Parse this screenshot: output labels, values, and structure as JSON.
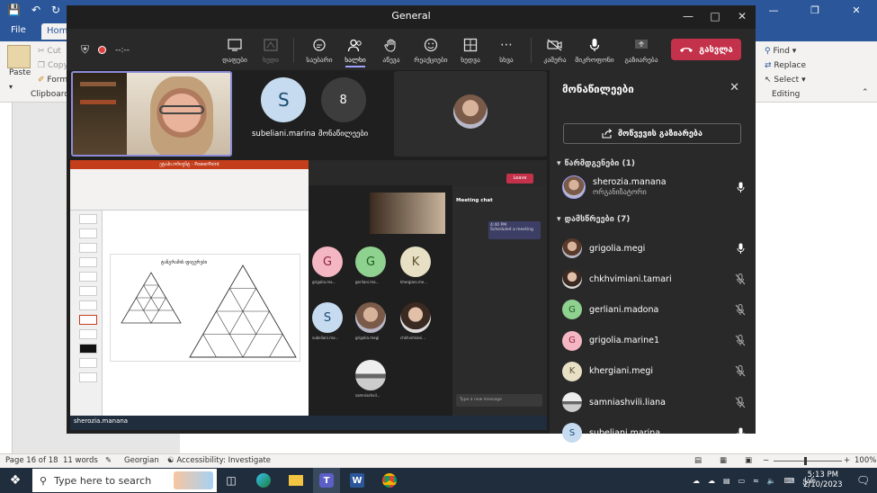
{
  "word": {
    "tabs": [
      "File",
      "Home"
    ],
    "clipboard": {
      "paste": "Paste",
      "cut": "Cut",
      "copy": "Copy",
      "format": "Forma",
      "group": "Clipboard"
    },
    "editing": {
      "find": "Find",
      "replace": "Replace",
      "select": "Select",
      "group": "Editing"
    },
    "status": {
      "page": "Page 16 of 18",
      "words": "11 words",
      "language": "Georgian",
      "accessibility": "Accessibility: Investigate",
      "zoom": "100%"
    }
  },
  "taskbar": {
    "search_placeholder": "Type here to search",
    "time": "5:13 PM",
    "date": "2/10/2023",
    "lang": "ქარ"
  },
  "teams": {
    "title": "General",
    "timer": "--:--",
    "toolbar": [
      {
        "id": "whiteboard",
        "label": "დაფები"
      },
      {
        "id": "view",
        "label": "ხედი",
        "dim": true
      },
      {
        "id": "chat",
        "label": "საუბარი"
      },
      {
        "id": "people",
        "label": "ხალხი",
        "active": true
      },
      {
        "id": "raise",
        "label": "აწევა"
      },
      {
        "id": "react",
        "label": "რეაქციები"
      },
      {
        "id": "rooms",
        "label": "ხედვა"
      },
      {
        "id": "more",
        "label": "სხვა"
      },
      {
        "id": "camera",
        "label": "კამერა"
      },
      {
        "id": "mic",
        "label": "მიკროფონი"
      },
      {
        "id": "share",
        "label": "გაზიარება"
      }
    ],
    "leave_label": "გასვლა",
    "tiles": {
      "s_initial": "S",
      "s_name": "subeliani.marina",
      "count": "8",
      "count_label": "მონაწილეები"
    },
    "shared_screen": {
      "presenter": "sherozia.manana",
      "ppt_title": "ეტაპი.ორიენტ - PowerPoint",
      "slide_title": "ტანგრამის ფიგურები",
      "meeting_chat": "Meeting chat",
      "chat_msg_time": "4:40 PM",
      "chat_msg": "Scheduled a meeting",
      "compose": "Type a new message",
      "leave": "Leave",
      "tile_initials": [
        "G",
        "G",
        "K",
        "S"
      ],
      "tile_names": [
        "grigolia.ma...",
        "gerliani.ma...",
        "khergiani.me...",
        "subeliani.ma...",
        "grigolia.megi",
        "chkhvimiani...",
        "samniashvil..."
      ]
    },
    "panel": {
      "title": "მონაწილეები",
      "share_invite": "მოწვევის გაზიარება",
      "presenters": "წარმდგენები (1)",
      "attendees": "დამსწრეები (7)",
      "organizer": {
        "name": "sherozia.manana",
        "role": "ორგანიზატორი"
      },
      "people": [
        {
          "name": "grigolia.megi",
          "avatar": "photo",
          "mic": "on"
        },
        {
          "name": "chkhvimiani.tamari",
          "avatar": "photo",
          "mic": "off"
        },
        {
          "name": "gerliani.madona",
          "avatar": "G",
          "color": "#8fd18f",
          "text": "#1b5e20",
          "mic": "off"
        },
        {
          "name": "grigolia.marine1",
          "avatar": "G",
          "color": "#f4b6c2",
          "text": "#8e2440",
          "mic": "off"
        },
        {
          "name": "khergiani.megi",
          "avatar": "K",
          "color": "#e7e0c4",
          "text": "#5d5330",
          "mic": "off"
        },
        {
          "name": "samniashvili.liana",
          "avatar": "photo",
          "mic": "off"
        },
        {
          "name": "subeliani.marina",
          "avatar": "S",
          "color": "#c6dbef",
          "text": "#1b4b72",
          "mic": "on"
        }
      ]
    }
  }
}
